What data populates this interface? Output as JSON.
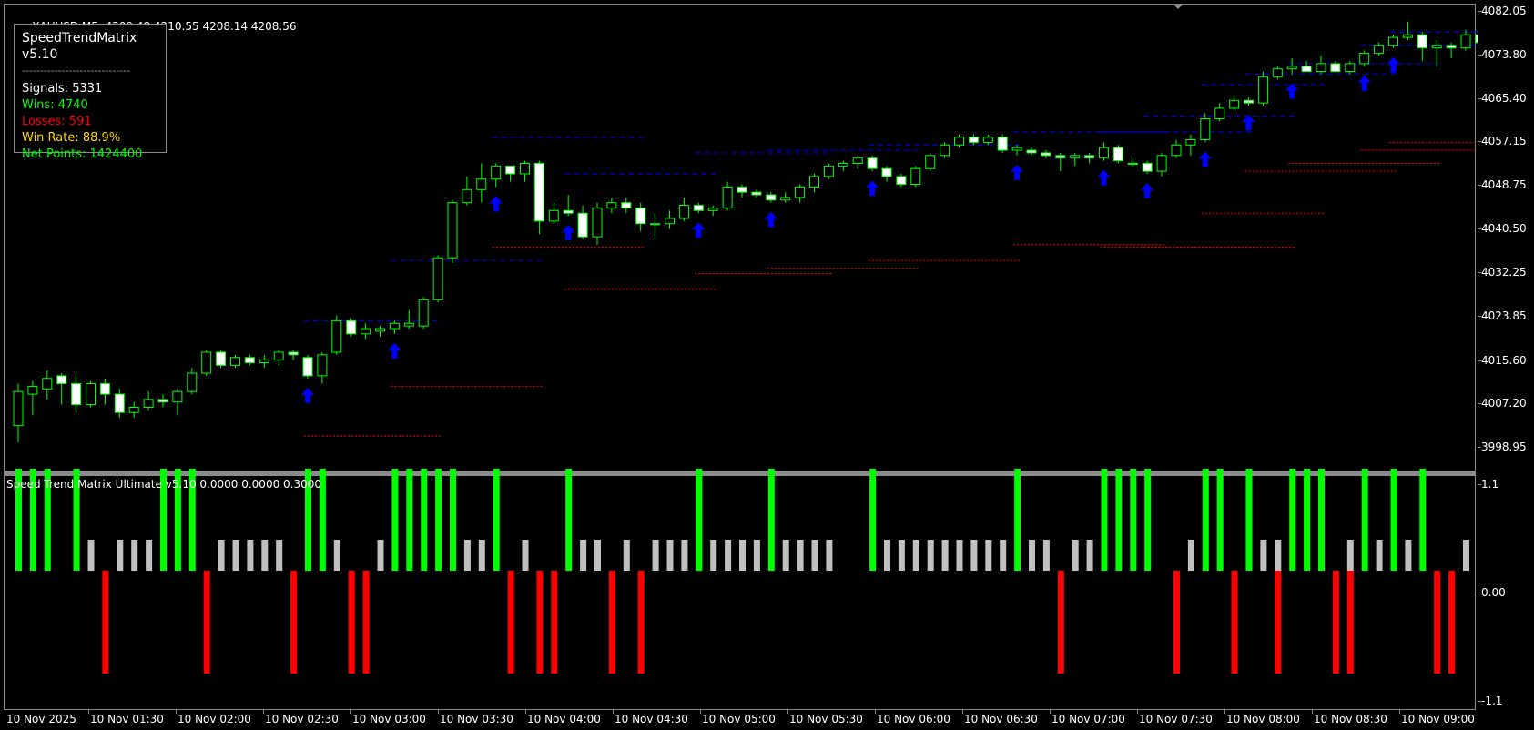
{
  "header": {
    "symbol": "XAUUSD,M5",
    "ohlc": "4209.48 4210.55 4208.14 4208.56"
  },
  "stats": {
    "title": "SpeedTrendMatrix v5.10",
    "separator": "------------------------------",
    "signals": "Signals: 5331",
    "wins": "Wins: 4740",
    "losses": "Losses: 591",
    "win_rate": "Win Rate: 88.9%",
    "net_points": "Net Points: 1424400"
  },
  "subwindow": {
    "title": "Speed Trend Matrix Ultimate v5.10 0.0000 0.0000 0.3000"
  },
  "price_axis": [
    "4082.05",
    "4073.80",
    "4065.40",
    "4057.15",
    "4048.75",
    "4040.50",
    "4032.25",
    "4023.85",
    "4015.60",
    "4007.20",
    "3998.95"
  ],
  "sub_axis": [
    "1.1",
    "0.00",
    "-1.1"
  ],
  "time_axis": [
    "10 Nov 2025",
    "10 Nov 01:30",
    "10 Nov 02:00",
    "10 Nov 02:30",
    "10 Nov 03:00",
    "10 Nov 03:30",
    "10 Nov 04:00",
    "10 Nov 04:30",
    "10 Nov 05:00",
    "10 Nov 05:30",
    "10 Nov 06:00",
    "10 Nov 06:30",
    "10 Nov 07:00",
    "10 Nov 07:30",
    "10 Nov 08:00",
    "10 Nov 08:30",
    "10 Nov 09:00"
  ],
  "colors": {
    "bull_candle": "#00ff00",
    "bear_body": "#ffffff",
    "up_arrow": "#0000ff",
    "resistance": "#0000cc",
    "support": "#ff0000",
    "hist_up": "#00ff00",
    "hist_down": "#ff0000",
    "hist_neutral": "#c0c0c0",
    "stats_wins": "#00ff00",
    "stats_losses": "#ff0000",
    "stats_winrate": "#ffd700",
    "stats_net": "#00ff00"
  },
  "candles": [
    [
      4003.0,
      4011.0,
      3999.8,
      4009.5
    ],
    [
      4009.0,
      4011.5,
      4005.0,
      4010.5
    ],
    [
      4010.0,
      4013.5,
      4008.0,
      4012.0
    ],
    [
      4012.5,
      4013.0,
      4007.0,
      4011.0
    ],
    [
      4011.0,
      4013.0,
      4005.5,
      4007.0
    ],
    [
      4007.0,
      4011.5,
      4006.5,
      4011.0
    ],
    [
      4011.0,
      4012.0,
      4007.0,
      4009.0
    ],
    [
      4009.0,
      4010.0,
      4004.5,
      4005.5
    ],
    [
      4005.5,
      4007.5,
      4004.5,
      4006.5
    ],
    [
      4006.5,
      4009.5,
      4006.0,
      4008.0
    ],
    [
      4008.0,
      4009.0,
      4006.5,
      4007.5
    ],
    [
      4007.5,
      4010.0,
      4005.0,
      4009.5
    ],
    [
      4009.5,
      4014.0,
      4009.0,
      4013.0
    ],
    [
      4013.0,
      4017.5,
      4012.5,
      4017.0
    ],
    [
      4017.0,
      4017.5,
      4014.0,
      4014.5
    ],
    [
      4014.5,
      4016.5,
      4014.0,
      4016.0
    ],
    [
      4016.0,
      4016.5,
      4014.5,
      4015.0
    ],
    [
      4015.0,
      4016.5,
      4014.0,
      4015.5
    ],
    [
      4015.5,
      4017.5,
      4014.5,
      4017.0
    ],
    [
      4017.0,
      4017.5,
      4015.5,
      4016.5
    ],
    [
      4016.0,
      4016.5,
      4012.0,
      4012.5
    ],
    [
      4012.5,
      4017.0,
      4011.0,
      4016.5
    ],
    [
      4017.0,
      4024.0,
      4016.5,
      4023.0
    ],
    [
      4023.0,
      4023.5,
      4020.0,
      4020.5
    ],
    [
      4020.5,
      4022.5,
      4019.5,
      4021.5
    ],
    [
      4021.0,
      4022.0,
      4020.0,
      4021.5
    ],
    [
      4021.5,
      4023.0,
      4020.5,
      4022.5
    ],
    [
      4022.0,
      4025.0,
      4021.5,
      4022.5
    ],
    [
      4022.0,
      4027.5,
      4021.5,
      4027.0
    ],
    [
      4027.0,
      4035.5,
      4026.5,
      4035.0
    ],
    [
      4035.0,
      4046.0,
      4034.0,
      4045.5
    ],
    [
      4045.5,
      4050.5,
      4045.0,
      4048.0
    ],
    [
      4048.0,
      4053.0,
      4045.5,
      4050.0
    ],
    [
      4050.0,
      4053.0,
      4048.5,
      4052.5
    ],
    [
      4052.5,
      4052.5,
      4049.5,
      4051.0
    ],
    [
      4051.0,
      4053.5,
      4049.5,
      4053.0
    ],
    [
      4053.0,
      4053.5,
      4039.5,
      4042.0
    ],
    [
      4042.0,
      4045.5,
      4041.5,
      4044.0
    ],
    [
      4044.0,
      4047.0,
      4043.0,
      4043.5
    ],
    [
      4043.5,
      4045.0,
      4038.5,
      4039.0
    ],
    [
      4039.0,
      4045.5,
      4037.5,
      4044.5
    ],
    [
      4044.5,
      4046.5,
      4043.5,
      4045.5
    ],
    [
      4045.5,
      4046.5,
      4043.5,
      4044.5
    ],
    [
      4044.5,
      4045.5,
      4040.0,
      4041.5
    ],
    [
      4041.5,
      4043.5,
      4038.5,
      4041.5
    ],
    [
      4041.5,
      4044.0,
      4040.5,
      4042.5
    ],
    [
      4042.5,
      4046.5,
      4042.0,
      4045.0
    ],
    [
      4045.0,
      4045.5,
      4043.5,
      4044.0
    ],
    [
      4044.0,
      4045.0,
      4043.0,
      4044.5
    ],
    [
      4044.5,
      4049.5,
      4044.0,
      4048.5
    ],
    [
      4048.5,
      4049.0,
      4046.5,
      4047.5
    ],
    [
      4047.5,
      4048.0,
      4046.5,
      4047.0
    ],
    [
      4047.0,
      4047.5,
      4045.5,
      4046.0
    ],
    [
      4046.0,
      4047.5,
      4045.5,
      4046.5
    ],
    [
      4046.5,
      4049.0,
      4045.5,
      4048.5
    ],
    [
      4048.5,
      4051.0,
      4047.5,
      4050.5
    ],
    [
      4050.5,
      4053.0,
      4050.0,
      4052.5
    ],
    [
      4052.5,
      4053.5,
      4051.5,
      4053.0
    ],
    [
      4053.0,
      4054.5,
      4052.0,
      4054.0
    ],
    [
      4054.0,
      4054.5,
      4051.5,
      4052.0
    ],
    [
      4052.0,
      4052.5,
      4049.5,
      4050.5
    ],
    [
      4050.5,
      4051.0,
      4048.5,
      4049.0
    ],
    [
      4049.0,
      4052.5,
      4048.5,
      4052.0
    ],
    [
      4052.0,
      4055.0,
      4051.5,
      4054.5
    ],
    [
      4054.5,
      4057.0,
      4054.0,
      4056.5
    ],
    [
      4056.5,
      4058.5,
      4056.0,
      4058.0
    ],
    [
      4058.0,
      4058.5,
      4056.5,
      4057.0
    ],
    [
      4057.0,
      4058.5,
      4056.5,
      4058.0
    ],
    [
      4058.0,
      4058.5,
      4055.0,
      4055.5
    ],
    [
      4055.5,
      4056.5,
      4054.5,
      4056.0
    ],
    [
      4055.5,
      4056.0,
      4054.5,
      4055.0
    ],
    [
      4055.0,
      4055.5,
      4054.0,
      4054.5
    ],
    [
      4054.5,
      4055.0,
      4051.5,
      4054.0
    ],
    [
      4054.0,
      4055.0,
      4052.5,
      4054.5
    ],
    [
      4054.5,
      4055.0,
      4053.0,
      4054.0
    ],
    [
      4054.0,
      4057.0,
      4053.5,
      4056.0
    ],
    [
      4056.0,
      4056.5,
      4053.0,
      4053.5
    ],
    [
      4053.0,
      4054.0,
      4052.5,
      4053.0
    ],
    [
      4053.0,
      4053.5,
      4051.0,
      4051.5
    ],
    [
      4051.5,
      4055.0,
      4050.5,
      4054.5
    ],
    [
      4054.5,
      4057.5,
      4054.0,
      4056.5
    ],
    [
      4056.5,
      4058.5,
      4054.5,
      4057.5
    ],
    [
      4057.5,
      4062.5,
      4057.0,
      4061.5
    ],
    [
      4061.5,
      4064.5,
      4061.0,
      4063.5
    ],
    [
      4063.5,
      4066.0,
      4063.0,
      4065.0
    ],
    [
      4065.0,
      4065.5,
      4064.0,
      4064.5
    ],
    [
      4064.5,
      4070.5,
      4064.0,
      4069.5
    ],
    [
      4069.5,
      4071.5,
      4069.0,
      4071.0
    ],
    [
      4071.0,
      4073.0,
      4070.0,
      4071.5
    ],
    [
      4071.5,
      4072.5,
      4070.5,
      4070.5
    ],
    [
      4070.5,
      4073.5,
      4070.0,
      4072.0
    ],
    [
      4072.0,
      4072.5,
      4070.5,
      4070.5
    ],
    [
      4070.5,
      4072.5,
      4070.0,
      4072.0
    ],
    [
      4072.0,
      4074.5,
      4071.5,
      4074.0
    ],
    [
      4074.0,
      4076.0,
      4073.5,
      4075.5
    ],
    [
      4075.5,
      4077.5,
      4075.0,
      4077.0
    ],
    [
      4077.0,
      4080.0,
      4076.5,
      4077.5
    ],
    [
      4077.5,
      4078.0,
      4072.5,
      4075.0
    ],
    [
      4075.0,
      4076.5,
      4071.5,
      4075.5
    ],
    [
      4075.5,
      4076.0,
      4073.0,
      4075.0
    ],
    [
      4075.0,
      4078.5,
      4074.5,
      4077.5
    ],
    [
      4077.5,
      4078.0,
      4075.5,
      4076.0
    ],
    [
      4076.0,
      4079.0,
      4075.5,
      4078.5
    ],
    [
      4078.5,
      4081.5,
      4078.0,
      4081.0
    ],
    [
      4081.0,
      4081.5,
      4077.5,
      4078.0
    ],
    [
      4078.0,
      4078.5,
      4074.0,
      4076.5
    ]
  ],
  "arrows": [
    20,
    26,
    33,
    38,
    47,
    52,
    59,
    69,
    75,
    78,
    82,
    85,
    88,
    93,
    95
  ],
  "histogram": {
    "up_idx": [
      0,
      1,
      2,
      4,
      10,
      11,
      12,
      20,
      21,
      26,
      27,
      28,
      29,
      30,
      33,
      38,
      47,
      52,
      59,
      69,
      75,
      76,
      77,
      78,
      82,
      83,
      85,
      88,
      89,
      90,
      93,
      95,
      97
    ],
    "neutral_idx": [
      5,
      7,
      8,
      9,
      14,
      15,
      16,
      17,
      18,
      22,
      25,
      31,
      32,
      35,
      39,
      40,
      42,
      44,
      45,
      46,
      48,
      49,
      50,
      51,
      53,
      54,
      55,
      56,
      60,
      61,
      62,
      63,
      64,
      65,
      66,
      67,
      68,
      70,
      71,
      73,
      74,
      81,
      86,
      87,
      92,
      94,
      96,
      100
    ],
    "down_idx": [
      6,
      13,
      19,
      23,
      24,
      34,
      36,
      37,
      41,
      43,
      72,
      80,
      84,
      87,
      91,
      92,
      98,
      99
    ]
  },
  "resistance_lines": [
    [
      20,
      29,
      4023.0
    ],
    [
      26,
      36,
      4034.5
    ],
    [
      33,
      43,
      4058.0
    ],
    [
      38,
      48,
      4051.0
    ],
    [
      47,
      56,
      4055.0
    ],
    [
      52,
      62,
      4055.5
    ],
    [
      59,
      69,
      4056.5
    ],
    [
      69,
      79,
      4059.0
    ],
    [
      75,
      85,
      4059.0
    ],
    [
      78,
      88,
      4062.0
    ],
    [
      82,
      90,
      4068.0
    ],
    [
      85,
      95,
      4070.0
    ],
    [
      88,
      98,
      4072.0
    ],
    [
      93,
      101,
      4075.5
    ],
    [
      95,
      102,
      4078.0
    ]
  ],
  "support_lines": [
    [
      20,
      29,
      4001.0
    ],
    [
      26,
      36,
      4010.5
    ],
    [
      33,
      43,
      4037.0
    ],
    [
      38,
      48,
      4029.0
    ],
    [
      47,
      56,
      4032.0
    ],
    [
      52,
      62,
      4033.0
    ],
    [
      59,
      69,
      4034.5
    ],
    [
      69,
      79,
      4037.5
    ],
    [
      75,
      85,
      4037.0
    ],
    [
      78,
      88,
      4037.0
    ],
    [
      82,
      90,
      4043.5
    ],
    [
      85,
      95,
      4051.5
    ],
    [
      88,
      98,
      4053.0
    ],
    [
      93,
      101,
      4055.5
    ],
    [
      95,
      102,
      4057.0
    ]
  ]
}
